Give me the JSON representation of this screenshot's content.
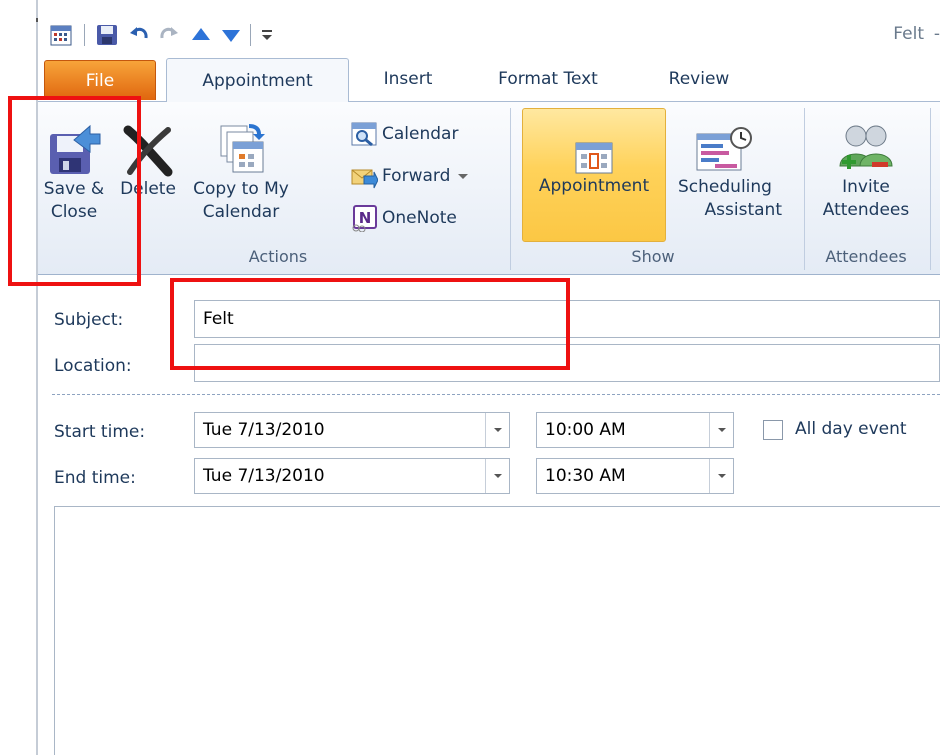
{
  "window": {
    "title": "Felt",
    "title_dash": "-"
  },
  "quick_access": {
    "calendar_icon": "calendar-icon",
    "save_icon": "save-icon",
    "undo_icon": "undo-icon",
    "redo_icon": "redo-icon",
    "up_icon": "arrow-up-icon",
    "down_icon": "arrow-down-icon",
    "customize_icon": "customize-icon"
  },
  "tabs": [
    {
      "label": "File"
    },
    {
      "label": "Appointment"
    },
    {
      "label": "Insert"
    },
    {
      "label": "Format Text"
    },
    {
      "label": "Review"
    }
  ],
  "ribbon": {
    "actions": {
      "group_label": "Actions",
      "save_close_line1": "Save &",
      "save_close_line2": "Close",
      "delete": "Delete",
      "copy_line1": "Copy to My",
      "copy_line2": "Calendar",
      "calendar": "Calendar",
      "forward": "Forward",
      "onenote": "OneNote"
    },
    "show": {
      "group_label": "Show",
      "appointment": "Appointment",
      "scheduling_line1": "Scheduling",
      "scheduling_line2": "Assistant"
    },
    "attendees": {
      "group_label": "Attendees",
      "invite_line1": "Invite",
      "invite_line2": "Attendees"
    }
  },
  "form": {
    "subject_label": "Subject:",
    "subject_value": "Felt",
    "location_label": "Location:",
    "location_value": "",
    "start_label": "Start time:",
    "start_date": "Tue 7/13/2010",
    "start_time": "10:00 AM",
    "end_label": "End time:",
    "end_date": "Tue 7/13/2010",
    "end_time": "10:30 AM",
    "all_day_label": "All day event",
    "all_day_checked": false
  },
  "colors": {
    "highlight": "#ee1111",
    "file_tab": "#e97a1f",
    "active_toggle": "#ffd25a"
  }
}
